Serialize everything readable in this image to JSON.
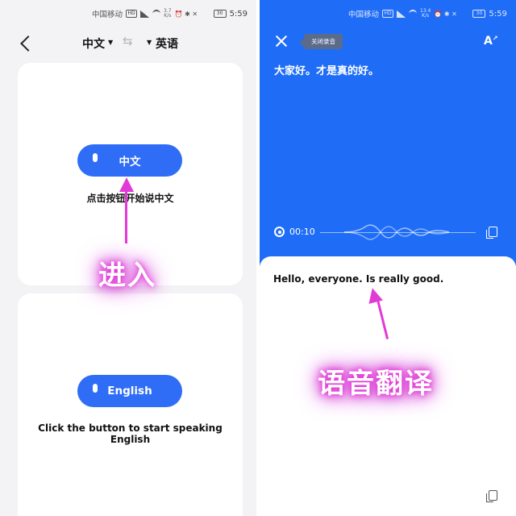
{
  "status_bar": {
    "carrier": "中国移动",
    "network_badge": "HD",
    "speed_left": "3.7\nK/s",
    "speed_right": "13.4\nK/s",
    "battery": "30",
    "time": "5:59"
  },
  "left_screen": {
    "source_lang": "中文",
    "target_lang": "英语",
    "chinese_button_label": "中文",
    "chinese_hint": "点击按钮开始说中文",
    "english_button_label": "English",
    "english_hint": "Click the button to start speaking English",
    "annotation": "进入"
  },
  "right_screen": {
    "close_recording_tooltip": "关闭录音",
    "source_text": "大家好。才是真的好。",
    "timer": "00:10",
    "translated_text": "Hello, everyone. Is really good.",
    "annotation": "语音翻译"
  },
  "colors": {
    "accent_blue": "#2f6df6",
    "header_blue": "#1f6df6",
    "annotation_magenta": "#e23ad7"
  },
  "icons": [
    "back-chevron-icon",
    "swap-icon",
    "mic-icon",
    "close-icon",
    "font-size-icon",
    "record-icon",
    "copy-icon"
  ]
}
